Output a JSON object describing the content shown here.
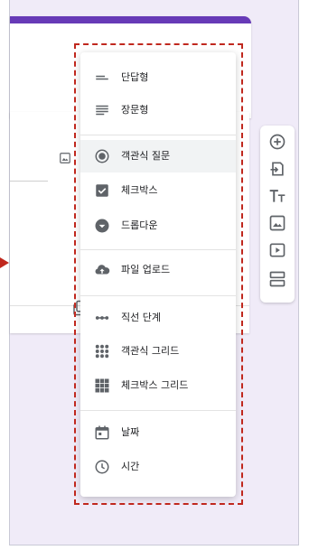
{
  "menu": {
    "items": [
      {
        "label": "단답형",
        "icon": "short-answer-icon"
      },
      {
        "label": "장문형",
        "icon": "paragraph-icon"
      },
      {
        "label": "객관식 질문",
        "icon": "radio-button-icon"
      },
      {
        "label": "체크박스",
        "icon": "checkbox-icon"
      },
      {
        "label": "드롭다운",
        "icon": "dropdown-icon"
      },
      {
        "label": "파일 업로드",
        "icon": "cloud-upload-icon"
      },
      {
        "label": "직선 단계",
        "icon": "linear-scale-icon"
      },
      {
        "label": "객관식 그리드",
        "icon": "multiple-choice-grid-icon"
      },
      {
        "label": "체크박스 그리드",
        "icon": "checkbox-grid-icon"
      },
      {
        "label": "날짜",
        "icon": "calendar-icon"
      },
      {
        "label": "시간",
        "icon": "clock-icon"
      }
    ]
  },
  "toolbar": {
    "tools": [
      "add-question-icon",
      "import-questions-icon",
      "add-title-icon",
      "add-image-icon",
      "add-video-icon",
      "add-section-icon"
    ]
  },
  "colors": {
    "theme": "#673ab7",
    "highlight": "#c0281e",
    "background": "#f0ebf8"
  }
}
